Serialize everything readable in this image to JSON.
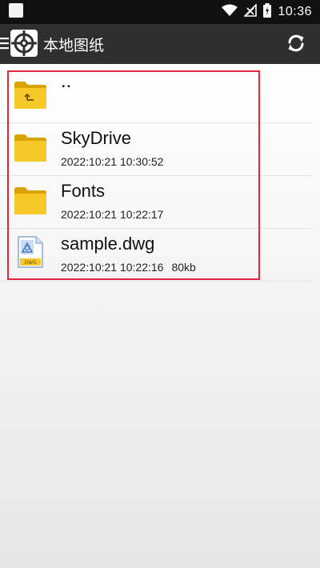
{
  "status_bar": {
    "time": "10:36",
    "icons": [
      "notification-icon",
      "wifi-icon",
      "signal-icon",
      "battery-icon"
    ]
  },
  "app_bar": {
    "title": "本地图纸",
    "icons": [
      "menu-icon",
      "app-logo-icon",
      "refresh-icon"
    ]
  },
  "files": [
    {
      "name": "..",
      "type": "parent-folder",
      "date": "",
      "size": ""
    },
    {
      "name": "SkyDrive",
      "type": "folder",
      "date": "2022:10:21 10:30:52",
      "size": ""
    },
    {
      "name": "Fonts",
      "type": "folder",
      "date": "2022:10:21 10:22:17",
      "size": ""
    },
    {
      "name": "sample.dwg",
      "type": "dwg-file",
      "date": "2022:10:21 10:22:16",
      "size": "80kb",
      "icon_label": "DWG"
    }
  ],
  "colors": {
    "status_bar_bg": "#111111",
    "app_bar_bg": "#2f2f2f",
    "highlight_border": "#e0283a",
    "folder_yellow": "#f5c518"
  }
}
